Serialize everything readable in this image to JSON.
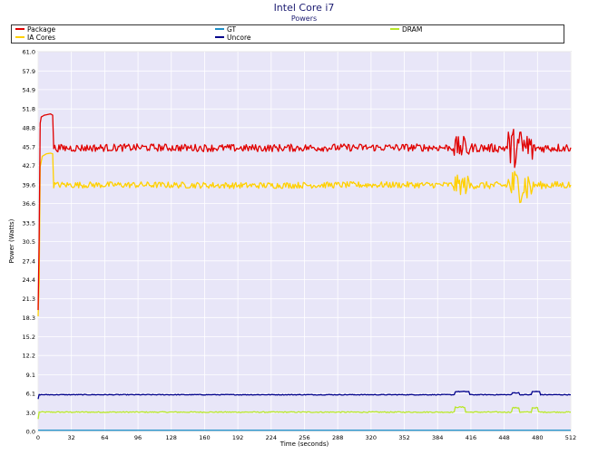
{
  "chart_data": {
    "type": "line",
    "title": "Intel Core i7",
    "subtitle": "Powers",
    "xlabel": "Time (seconds)",
    "ylabel": "Power (Watts)",
    "xlim": [
      0,
      512
    ],
    "ylim": [
      0,
      61.0
    ],
    "x_ticks": [
      "0",
      "32",
      "64",
      "96",
      "128",
      "160",
      "192",
      "224",
      "256",
      "288",
      "320",
      "352",
      "384",
      "416",
      "448",
      "480",
      "512"
    ],
    "y_ticks": [
      "0.0",
      "3.0",
      "6.1",
      "9.1",
      "12.2",
      "15.2",
      "18.3",
      "21.3",
      "24.4",
      "27.4",
      "30.5",
      "33.5",
      "36.6",
      "39.6",
      "42.7",
      "45.7",
      "48.8",
      "51.8",
      "54.9",
      "57.9",
      "61.0"
    ],
    "grid": true,
    "legend_position": "top",
    "series": [
      {
        "name": "Package",
        "color": "#e00000",
        "points": [
          [
            0,
            19.5
          ],
          [
            1,
            31
          ],
          [
            2,
            49.5
          ],
          [
            3,
            50.5
          ],
          [
            6,
            50.8
          ],
          [
            9,
            50.9
          ],
          [
            12,
            51
          ],
          [
            14,
            50.8
          ],
          [
            15,
            45.5
          ],
          [
            100,
            45.6
          ],
          [
            200,
            45.5
          ],
          [
            300,
            45.6
          ],
          [
            400,
            45.6
          ],
          [
            410,
            45.6
          ],
          [
            440,
            45.5
          ],
          [
            460,
            45.6
          ],
          [
            480,
            45.5
          ],
          [
            512,
            45.6
          ]
        ],
        "noise": [
          {
            "from": 15,
            "to": 400,
            "amp": 0.6
          },
          {
            "from": 400,
            "to": 416,
            "amp": 1.8
          },
          {
            "from": 416,
            "to": 452,
            "amp": 0.7
          },
          {
            "from": 452,
            "to": 476,
            "amp": 3.2
          },
          {
            "from": 476,
            "to": 512,
            "amp": 0.7
          }
        ]
      },
      {
        "name": "GT",
        "color": "#1e90c8",
        "points": [
          [
            0,
            0.2
          ],
          [
            512,
            0.2
          ]
        ],
        "noise": []
      },
      {
        "name": "DRAM",
        "color": "#b8e62a",
        "points": [
          [
            0,
            2.0
          ],
          [
            1,
            3.1
          ],
          [
            400,
            3.1
          ],
          [
            401,
            3.9
          ],
          [
            410,
            3.9
          ],
          [
            411,
            3.1
          ],
          [
            455,
            3.1
          ],
          [
            456,
            3.8
          ],
          [
            462,
            3.8
          ],
          [
            463,
            3.1
          ],
          [
            474,
            3.1
          ],
          [
            475,
            3.8
          ],
          [
            480,
            3.8
          ],
          [
            481,
            3.1
          ],
          [
            512,
            3.1
          ]
        ],
        "noise": [
          {
            "from": 1,
            "to": 512,
            "amp": 0.08
          }
        ]
      },
      {
        "name": "IA Cores",
        "color": "#ffd000",
        "points": [
          [
            0,
            18.5
          ],
          [
            1,
            24
          ],
          [
            2,
            42.5
          ],
          [
            4,
            44.2
          ],
          [
            8,
            44.6
          ],
          [
            12,
            44.7
          ],
          [
            14,
            44.6
          ],
          [
            15,
            39.6
          ],
          [
            100,
            39.6
          ],
          [
            200,
            39.5
          ],
          [
            300,
            39.6
          ],
          [
            400,
            39.6
          ],
          [
            440,
            39.5
          ],
          [
            512,
            39.6
          ]
        ],
        "noise": [
          {
            "from": 15,
            "to": 400,
            "amp": 0.5
          },
          {
            "from": 400,
            "to": 416,
            "amp": 1.6
          },
          {
            "from": 416,
            "to": 452,
            "amp": 0.6
          },
          {
            "from": 452,
            "to": 476,
            "amp": 2.8
          },
          {
            "from": 476,
            "to": 512,
            "amp": 0.6
          }
        ]
      },
      {
        "name": "Uncore",
        "color": "#00008b",
        "points": [
          [
            0,
            5.2
          ],
          [
            1,
            5.9
          ],
          [
            400,
            5.9
          ],
          [
            401,
            6.4
          ],
          [
            414,
            6.4
          ],
          [
            415,
            5.9
          ],
          [
            455,
            5.9
          ],
          [
            456,
            6.2
          ],
          [
            462,
            6.2
          ],
          [
            463,
            5.9
          ],
          [
            474,
            5.9
          ],
          [
            475,
            6.4
          ],
          [
            482,
            6.4
          ],
          [
            483,
            5.9
          ],
          [
            512,
            5.9
          ]
        ],
        "noise": [
          {
            "from": 1,
            "to": 512,
            "amp": 0.06
          }
        ]
      }
    ]
  }
}
